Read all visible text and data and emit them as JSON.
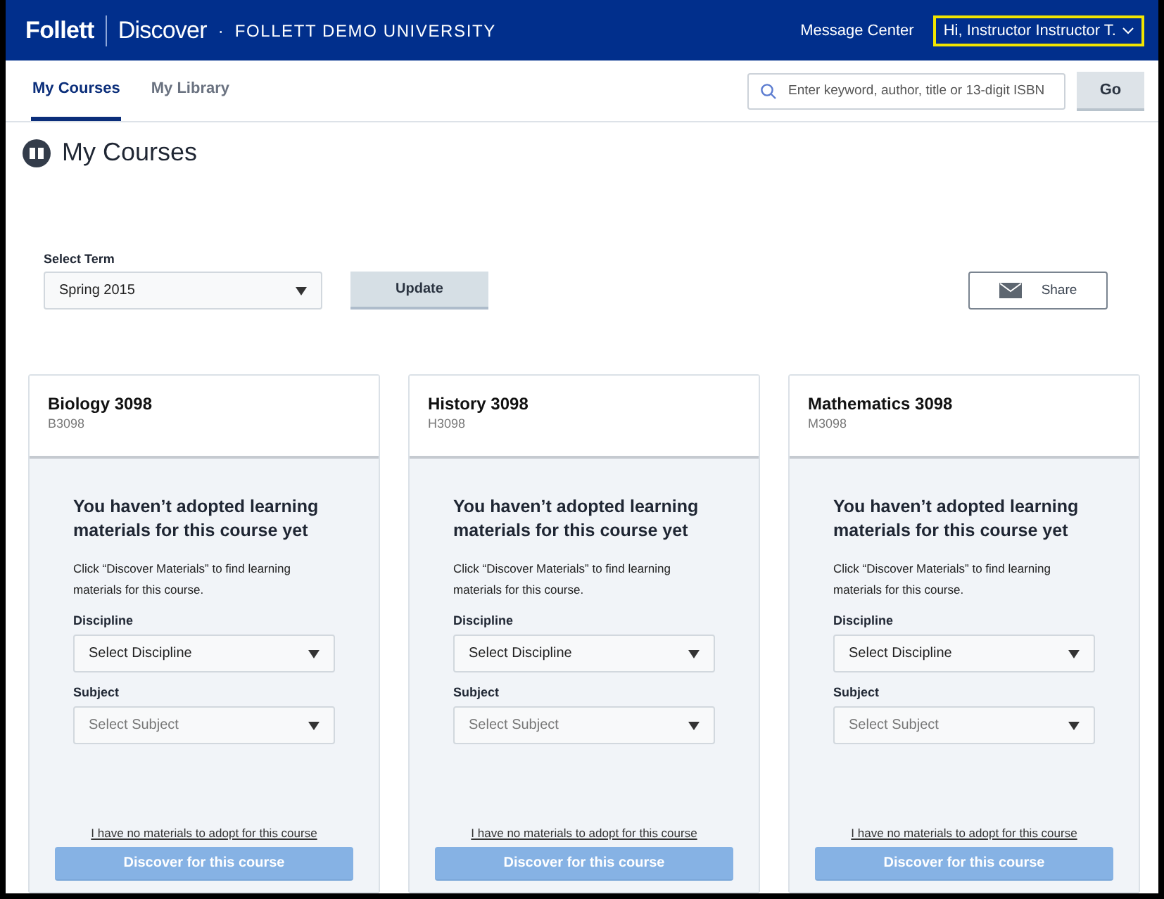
{
  "header": {
    "brand": "Follett",
    "product": "Discover",
    "separator": "·",
    "institution": "FOLLETT DEMO UNIVERSITY",
    "message_center": "Message Center",
    "user_menu": {
      "label": "Hi, Instructor Instructor T.",
      "highlighted": true
    }
  },
  "tabs": [
    {
      "label": "My Courses",
      "selected": true
    },
    {
      "label": "My Library",
      "selected": false
    }
  ],
  "search": {
    "placeholder": "Enter keyword, author, title or 13-digit ISBN",
    "button": "Go"
  },
  "page_title": "My Courses",
  "term": {
    "label": "Select Term",
    "value": "Spring 2015",
    "update": "Update",
    "share": "Share"
  },
  "courses": [
    {
      "name": "Biology 3098",
      "code": "B3098",
      "heading": "You haven’t adopted learning materials for this course yet",
      "hint": "Click “Discover Materials” to find learning materials for this course.",
      "discipline": {
        "label": "Discipline",
        "value": "Select Discipline",
        "disabled": false
      },
      "subject": {
        "label": "Subject",
        "value": "Select Subject",
        "disabled": true
      },
      "no_materials": "I have no materials to adopt for this course",
      "discover": {
        "label": "Discover for this course",
        "disabled": true
      }
    },
    {
      "name": "History 3098",
      "code": "H3098",
      "heading": "You haven’t adopted learning materials for this course yet",
      "hint": "Click “Discover Materials” to find learning materials for this course.",
      "discipline": {
        "label": "Discipline",
        "value": "Select Discipline",
        "disabled": false
      },
      "subject": {
        "label": "Subject",
        "value": "Select Subject",
        "disabled": true
      },
      "no_materials": "I have no materials to adopt for this course",
      "discover": {
        "label": "Discover for this course",
        "disabled": true
      }
    },
    {
      "name": "Mathematics 3098",
      "code": "M3098",
      "heading": "You haven’t adopted learning materials for this course yet",
      "hint": "Click “Discover Materials” to find learning materials for this course.",
      "discipline": {
        "label": "Discipline",
        "value": "Select Discipline",
        "disabled": false
      },
      "subject": {
        "label": "Subject",
        "value": "Select Subject",
        "disabled": true
      },
      "no_materials": "I have no materials to adopt for this course",
      "discover": {
        "label": "Discover for this course",
        "disabled": true
      }
    }
  ]
}
